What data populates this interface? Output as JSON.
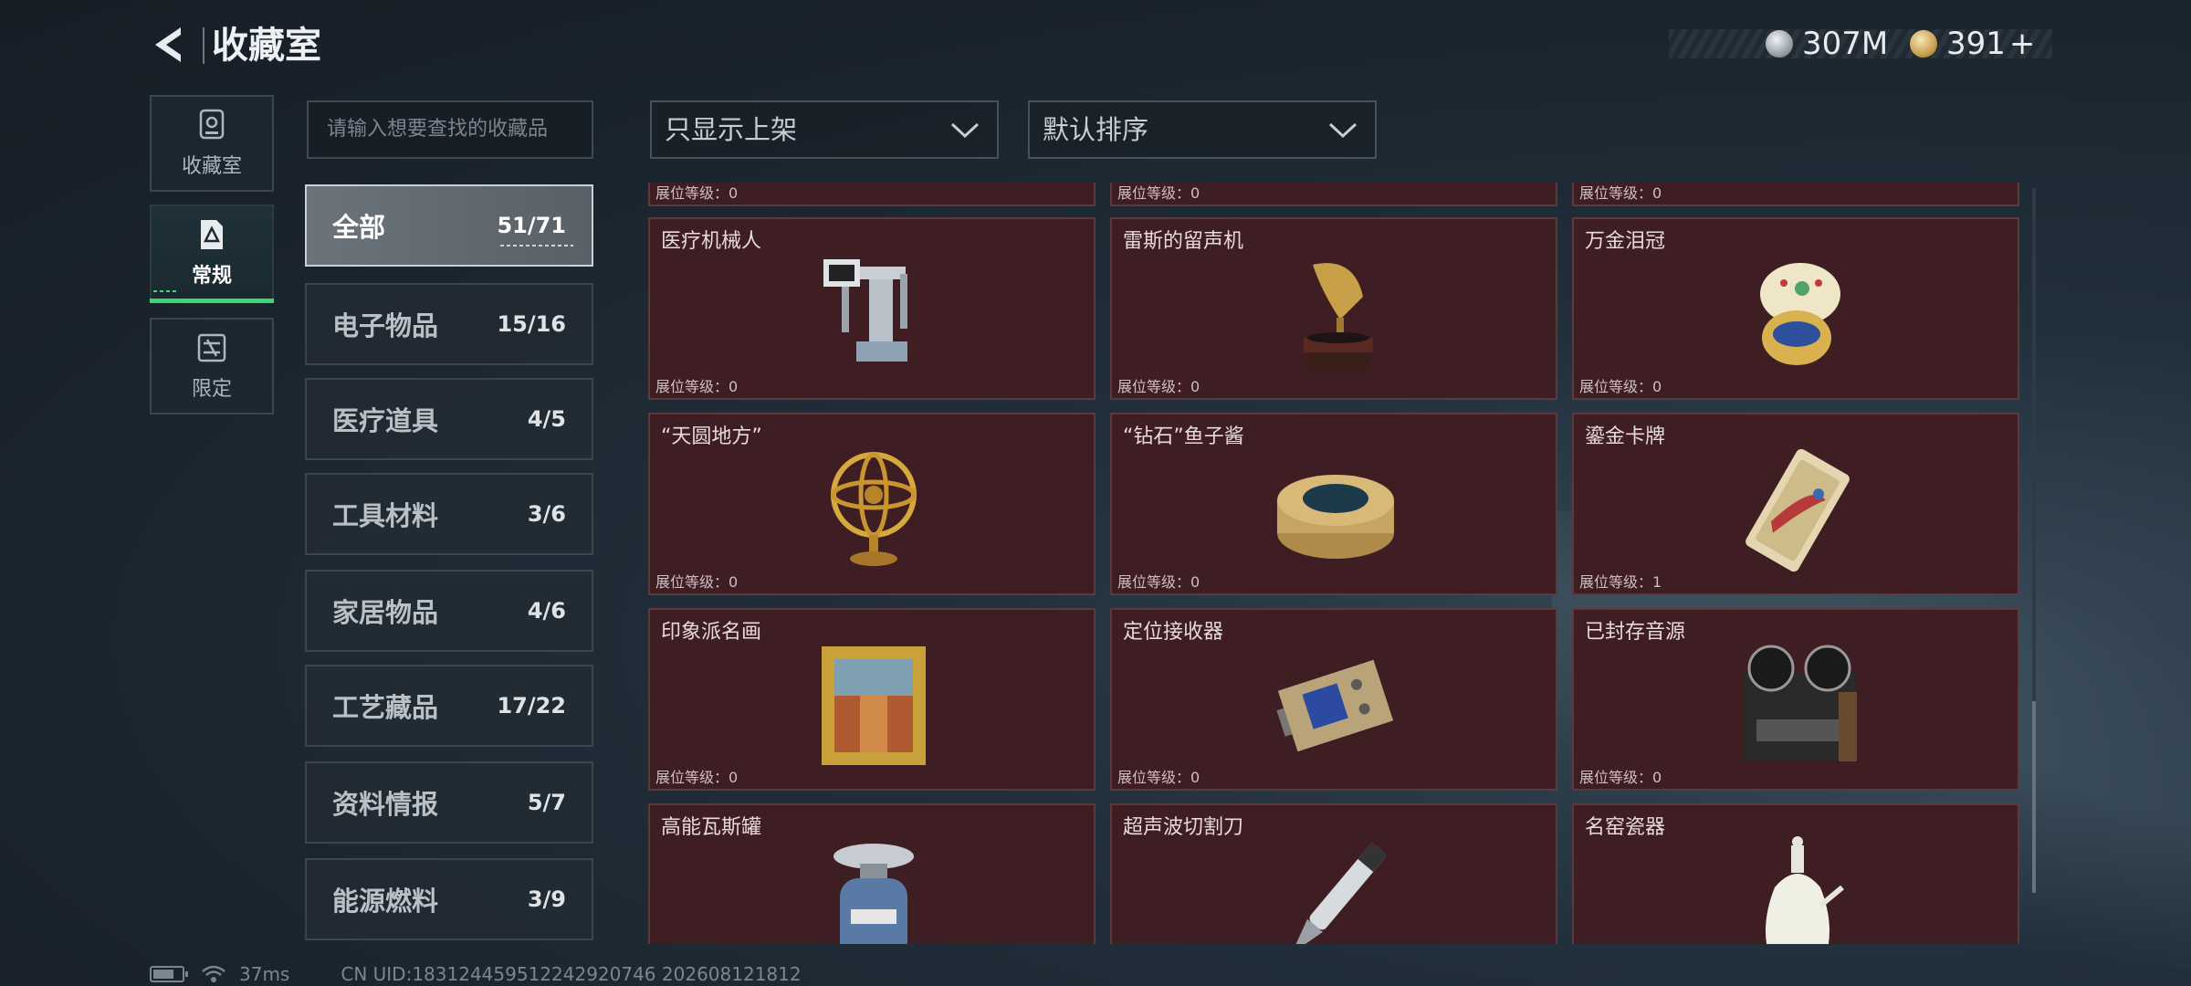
{
  "header": {
    "title": "收藏室",
    "currencies": [
      {
        "icon": "silver-coin-icon",
        "value": "307M"
      },
      {
        "icon": "gold-coin-icon",
        "value": "391",
        "plus": "+"
      }
    ]
  },
  "nav": [
    {
      "label": "收藏室",
      "icon": "vault-icon",
      "active": false
    },
    {
      "label": "常规",
      "icon": "document-icon",
      "active": true
    },
    {
      "label": "限定",
      "icon": "limited-icon",
      "active": false
    }
  ],
  "search": {
    "placeholder": "请输入想要查找的收藏品"
  },
  "categories": [
    {
      "name": "全部",
      "count": "51/71",
      "active": true
    },
    {
      "name": "电子物品",
      "count": "15/16"
    },
    {
      "name": "医疗道具",
      "count": "4/5"
    },
    {
      "name": "工具材料",
      "count": "3/6"
    },
    {
      "name": "家居物品",
      "count": "4/6"
    },
    {
      "name": "工艺藏品",
      "count": "17/22"
    },
    {
      "name": "资料情报",
      "count": "5/7"
    },
    {
      "name": "能源燃料",
      "count": "3/9"
    }
  ],
  "filters": {
    "display": "只显示上架",
    "sort": "默认排序"
  },
  "level_prefix": "展位等级：",
  "partial_row_levels": [
    "展位等级：0",
    "展位等级：0",
    "展位等级：0"
  ],
  "items": [
    {
      "name": "医疗机械人",
      "level": "展位等级：0",
      "icon": "medical-robot-icon"
    },
    {
      "name": "雷斯的留声机",
      "level": "展位等级：0",
      "icon": "gramophone-icon"
    },
    {
      "name": "万金泪冠",
      "level": "展位等级：0",
      "icon": "jeweled-egg-icon"
    },
    {
      "name": "“天圆地方”",
      "level": "展位等级：0",
      "icon": "armillary-sphere-icon"
    },
    {
      "name": "“钻石”鱼子酱",
      "level": "展位等级：0",
      "icon": "caviar-tin-icon"
    },
    {
      "name": "鎏金卡牌",
      "level": "展位等级：1",
      "icon": "gilded-card-icon"
    },
    {
      "name": "印象派名画",
      "level": "展位等级：0",
      "icon": "framed-painting-icon"
    },
    {
      "name": "定位接收器",
      "level": "展位等级：0",
      "icon": "receiver-device-icon"
    },
    {
      "name": "已封存音源",
      "level": "展位等级：0",
      "icon": "tape-recorder-icon"
    },
    {
      "name": "高能瓦斯罐",
      "level": "",
      "icon": "gas-canister-icon"
    },
    {
      "name": "超声波切割刀",
      "level": "",
      "icon": "ultrasonic-knife-icon"
    },
    {
      "name": "名窑瓷器",
      "level": "",
      "icon": "porcelain-vase-icon"
    }
  ],
  "footer": {
    "latency": "37ms",
    "uid": "CN UID:183124459512242920746 202608121812"
  },
  "colors": {
    "card_bg": "#3e1e22",
    "active_accent": "#3cd675"
  }
}
